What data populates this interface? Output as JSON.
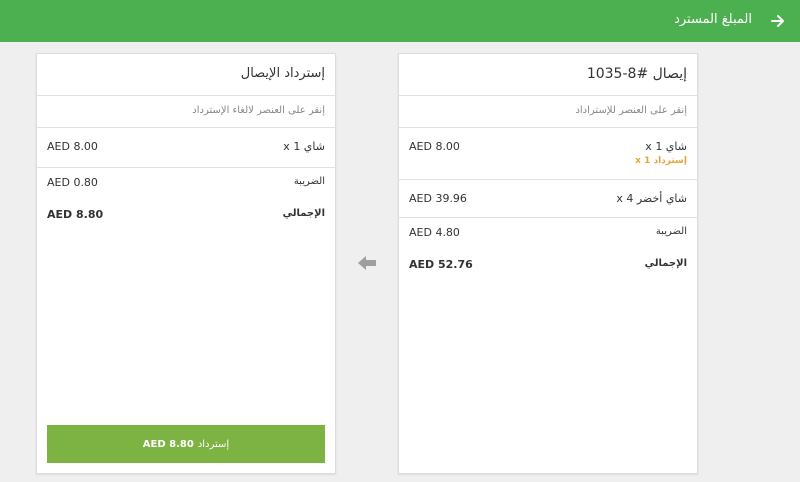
{
  "header": {
    "title": "المبلغ المسترد",
    "back_icon": "arrow-right-icon",
    "color": "#4caf50"
  },
  "receipt": {
    "title": "إيصال #8-1035",
    "hint": "إنقر على العنصر للإستراداد",
    "items": [
      {
        "name": "شاي 1 x",
        "price": "AED 8.00",
        "refund_note": "إسترداد 1 x"
      },
      {
        "name": "شاي أخضر 4 x",
        "price": "AED 39.96"
      }
    ],
    "tax_label": "الضريبة",
    "tax_value": "AED 4.80",
    "total_label": "الإجمالي",
    "total_value": "AED 52.76"
  },
  "refund": {
    "title": "إسترداد الإيصال",
    "hint": "إنقر على العنصر لالغاء الإسترداد",
    "items": [
      {
        "name": "شاي 1 x",
        "price": "AED 8.00"
      }
    ],
    "tax_label": "الضريبة",
    "tax_value": "AED 0.80",
    "total_label": "الإجمالي",
    "total_value": "AED 8.80",
    "button_label": "إسترداد",
    "button_amount": "AED 8.80",
    "button_color": "#7cb342"
  },
  "transfer_icon": "arrow-left-icon",
  "accent_refund_color": "#e8a33a"
}
